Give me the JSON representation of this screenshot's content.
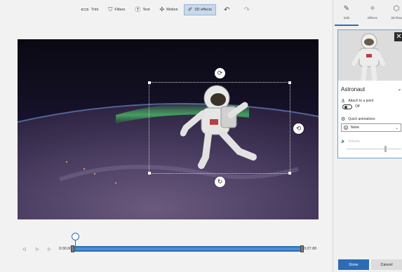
{
  "toolbar": {
    "trim": {
      "label": "Trim",
      "icon": "trim-icon"
    },
    "filters": {
      "label": "Filters",
      "icon": "filters-icon"
    },
    "text": {
      "label": "Text",
      "icon": "text-icon"
    },
    "motion": {
      "label": "Motion",
      "icon": "motion-icon"
    },
    "effects3d": {
      "label": "3D effects",
      "icon": "3d-effects-icon",
      "active": true
    },
    "undo_icon": "undo-icon",
    "redo_icon": "redo-icon"
  },
  "timeline": {
    "current_time": "0:00.00",
    "end_time": "0:27.80",
    "controls": [
      "rewind-icon",
      "play-icon",
      "step-forward-icon"
    ]
  },
  "panel": {
    "tabs": [
      {
        "label": "Edit",
        "icon": "pencil-icon",
        "active": true
      },
      {
        "label": "Effects",
        "icon": "effects-icon",
        "active": false
      },
      {
        "label": "3D libra",
        "icon": "3d-library-icon",
        "active": false
      }
    ],
    "card": {
      "title": "Astronaut",
      "attach_label": "Attach to a point",
      "attach_toggle_state": "Off",
      "quick_animations_label": "Quick animations",
      "quick_animations_value": "None",
      "volume_label": "Volume",
      "volume_level": 0.7
    },
    "done_label": "Done",
    "cancel_label": "Cancel"
  },
  "colors": {
    "accent": "#2b6cb5",
    "timeline": "#2e6eb3"
  }
}
